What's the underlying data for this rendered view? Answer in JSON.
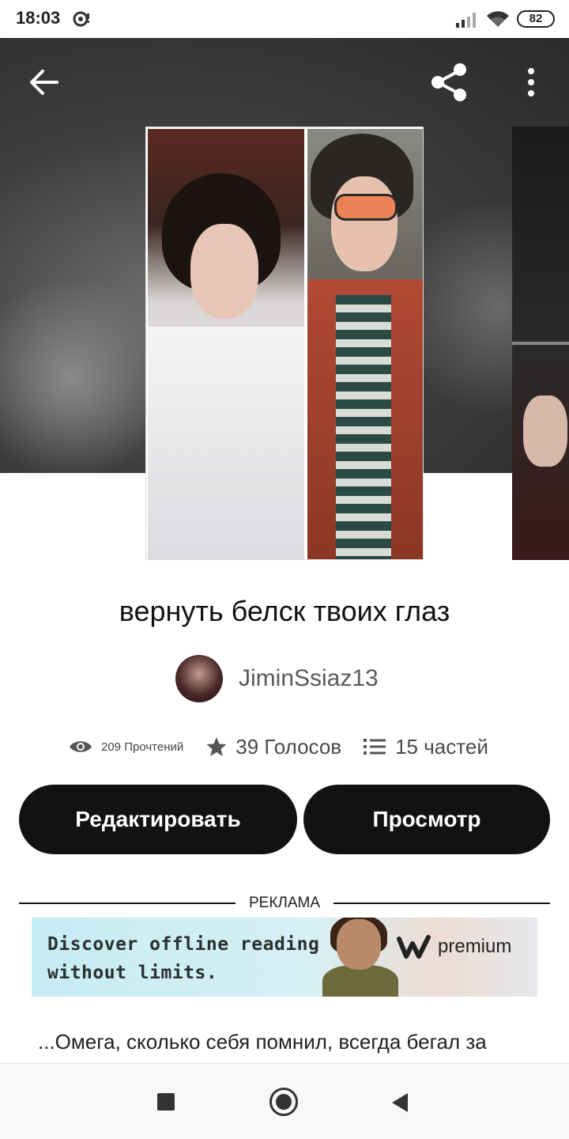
{
  "status_bar": {
    "time": "18:03",
    "battery": "82",
    "icons": [
      "notification-icon",
      "signal-icon",
      "wifi-icon",
      "battery-icon"
    ]
  },
  "header": {
    "icons": [
      "back-arrow-icon",
      "share-icon",
      "more-vertical-icon"
    ]
  },
  "story": {
    "title": "вернуть белск твоих глаз",
    "author": "JiminSsiaz13",
    "reads": "209 Прочтений",
    "votes": "39 Голосов",
    "parts": "15 частей",
    "description": "...Омега, сколько себя помнил, всегда бегал за"
  },
  "buttons": {
    "edit": "Редактировать",
    "view": "Просмотр"
  },
  "ad": {
    "label": "РЕКЛАМА",
    "line1": "Discover offline reading",
    "line2": "without limits.",
    "brand": "premium"
  },
  "colors": {
    "primary_button": "#121212",
    "header_bg": "#3e3e3e",
    "ad_bg": "#c6ecf4"
  }
}
